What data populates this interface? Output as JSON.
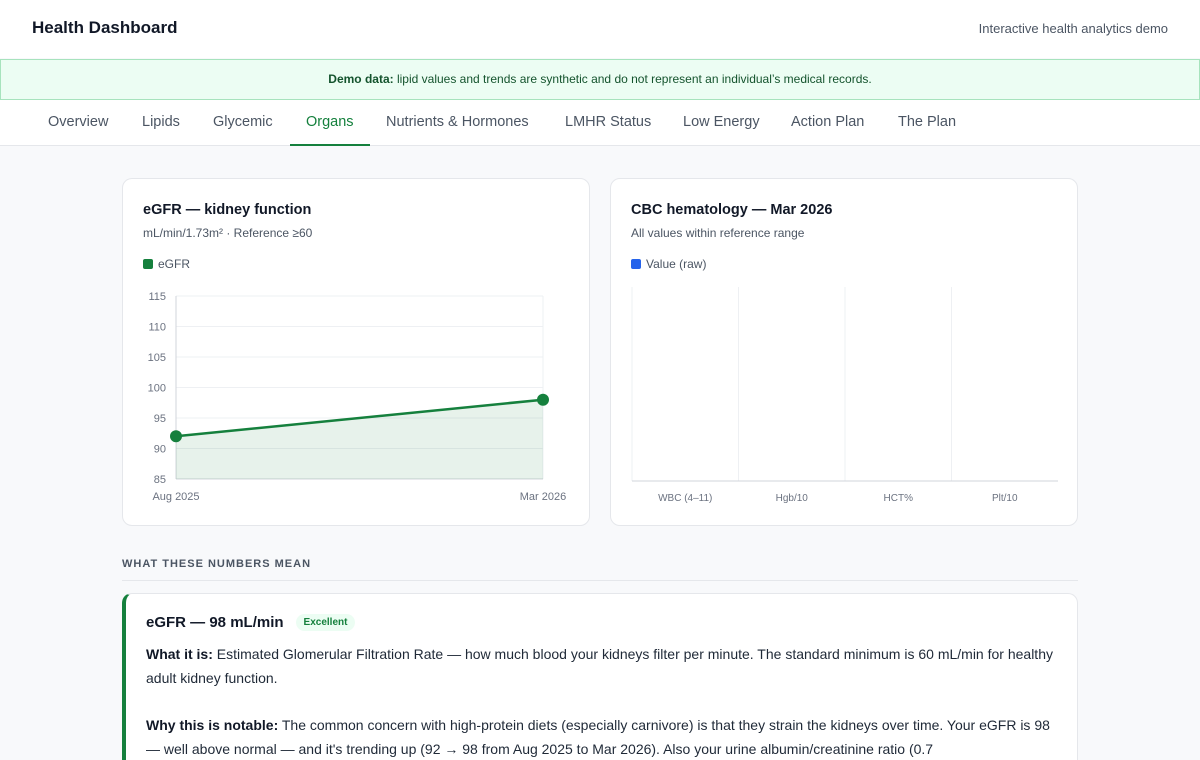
{
  "header": {
    "title": "Health Dashboard",
    "subtitle": "Interactive health analytics demo"
  },
  "banner": {
    "strong": "Demo data:",
    "text": " lipid values and trends are synthetic and do not represent an individual’s medical records."
  },
  "tabs": [
    {
      "label": "Overview"
    },
    {
      "label": "Lipids"
    },
    {
      "label": "Glycemic"
    },
    {
      "label": "Organs",
      "active": true
    },
    {
      "label": "Nutrients & Hormones"
    },
    {
      "label": "LMHR Status"
    },
    {
      "label": "Low Energy"
    },
    {
      "label": "Action Plan"
    },
    {
      "label": "The Plan"
    }
  ],
  "egfr_card": {
    "title": "eGFR — kidney function",
    "subtitle": "mL/min/1.73m² · Reference ≥60",
    "legend": "eGFR",
    "color": "#15803d"
  },
  "cbc_card": {
    "title": "CBC hematology — Mar 2026",
    "subtitle": "All values within reference range",
    "legend": "Value (raw)",
    "color": "#2563eb"
  },
  "chart_data": [
    {
      "type": "area",
      "x": [
        "Aug 2025",
        "Mar 2026"
      ],
      "series": [
        {
          "name": "eGFR",
          "values": [
            92,
            98
          ]
        }
      ],
      "yticks": [
        85,
        90,
        95,
        100,
        105,
        110,
        115
      ],
      "ylim": [
        85,
        115
      ],
      "grid": true,
      "legend": "top-left"
    },
    {
      "type": "bar",
      "categories": [
        "WBC (4–11)",
        "Hgb/10",
        "HCT%",
        "Plt/10"
      ],
      "series": [
        {
          "name": "Value (raw)",
          "values": []
        }
      ],
      "grid": true,
      "legend": "top-left"
    }
  ],
  "section": {
    "label": "WHAT THESE NUMBERS MEAN"
  },
  "info": {
    "title": "eGFR — 98 mL/min",
    "badge": "Excellent",
    "what_label": "What it is:",
    "what_text": " Estimated Glomerular Filtration Rate — how much blood your kidneys filter per minute. The standard minimum is 60 mL/min for healthy adult kidney function.",
    "why_label": "Why this is notable:",
    "why_text": " The common concern with high-protein diets (especially carnivore) is that they strain the kidneys over time. Your eGFR is 98 — well above normal — and it's trending up (92 → 98 from Aug 2025 to Mar 2026). Also your urine albumin/creatinine ratio (0.7"
  }
}
